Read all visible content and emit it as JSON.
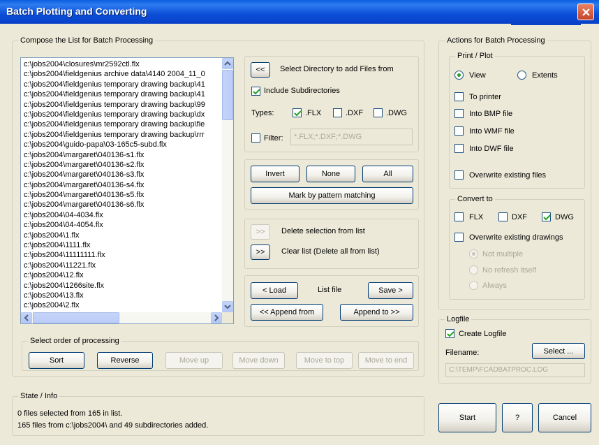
{
  "window": {
    "title": "Batch Plotting and Converting"
  },
  "compose": {
    "legend": "Compose the List for Batch Processing",
    "files": [
      "c:\\jobs2004\\closures\\mr2592ctl.flx",
      "c:\\jobs2004\\fieldgenius archive data\\4140 2004_11_0",
      "c:\\jobs2004\\fieldgenius temporary drawing backup\\41",
      "c:\\jobs2004\\fieldgenius temporary drawing backup\\41",
      "c:\\jobs2004\\fieldgenius temporary drawing backup\\99",
      "c:\\jobs2004\\fieldgenius temporary drawing backup\\dx",
      "c:\\jobs2004\\fieldgenius temporary drawing backup\\fie",
      "c:\\jobs2004\\fieldgenius temporary drawing backup\\rrr",
      "c:\\jobs2004\\guido-papa\\03-165c5-subd.flx",
      "c:\\jobs2004\\margaret\\040136-s1.flx",
      "c:\\jobs2004\\margaret\\040136-s2.flx",
      "c:\\jobs2004\\margaret\\040136-s3.flx",
      "c:\\jobs2004\\margaret\\040136-s4.flx",
      "c:\\jobs2004\\margaret\\040136-s5.flx",
      "c:\\jobs2004\\margaret\\040136-s6.flx",
      "c:\\jobs2004\\04-4034.flx",
      "c:\\jobs2004\\04-4054.flx",
      "c:\\jobs2004\\1.flx",
      "c:\\jobs2004\\1111.flx",
      "c:\\jobs2004\\11111111.flx",
      "c:\\jobs2004\\11221.flx",
      "c:\\jobs2004\\12.flx",
      "c:\\jobs2004\\1266site.flx",
      "c:\\jobs2004\\13.flx",
      "c:\\jobs2004\\2.flx"
    ],
    "select_dir_button": "<<",
    "select_dir_label": "Select Directory to add Files from",
    "include_subdirs": {
      "label": "Include Subdirectories",
      "checked": true
    },
    "types_label": "Types:",
    "types": [
      {
        "label": ".FLX",
        "checked": true
      },
      {
        "label": ".DXF",
        "checked": false
      },
      {
        "label": ".DWG",
        "checked": false
      }
    ],
    "filter": {
      "label": "Filter:",
      "checked": false,
      "value": "*.FLX;*.DXF;*.DWG"
    },
    "invert_button": "Invert",
    "none_button": "None",
    "all_button": "All",
    "mark_pattern_button": "Mark by pattern matching",
    "delete_sel_button": ">>",
    "delete_sel_label": "Delete selection from list",
    "clear_list_button": ">>",
    "clear_list_label": "Clear list (Delete all from list)",
    "load_button": "< Load",
    "list_file_label": "List file",
    "save_button": "Save >",
    "append_from_button": "<< Append from",
    "append_to_button": "Append to >>"
  },
  "order": {
    "legend": "Select order of processing",
    "sort_button": "Sort",
    "reverse_button": "Reverse",
    "move_up_button": "Move up",
    "move_down_button": "Move down",
    "move_top_button": "Move to top",
    "move_end_button": "Move to end"
  },
  "state": {
    "legend": "State / Info",
    "line1": "0 files selected from 165 in list.",
    "line2": "165 files from c:\\jobs2004\\ and 49 subdirectories added."
  },
  "actions": {
    "legend": "Actions for Batch Processing",
    "print_plot": {
      "legend": "Print / Plot",
      "view_label": "View",
      "extents_label": "Extents",
      "selected": "View",
      "to_printer": "To printer",
      "into_bmp": "Into BMP file",
      "into_wmf": "Into WMF file",
      "into_dwf": "Into DWF file",
      "overwrite_files": "Overwrite existing files"
    },
    "convert_to": {
      "legend": "Convert to",
      "flx": {
        "label": "FLX",
        "checked": false
      },
      "dxf": {
        "label": "DXF",
        "checked": false
      },
      "dwg": {
        "label": "DWG",
        "checked": true
      },
      "overwrite_drawings": "Overwrite existing drawings",
      "not_multiple": "Not multiple",
      "no_refresh": "No refresh itself",
      "always": "Always"
    },
    "logfile": {
      "legend": "Logfile",
      "create_label": "Create Logfile",
      "create_checked": true,
      "filename_label": "Filename:",
      "select_button": "Select ...",
      "filename_value": "C:\\TEMP\\FCADBATPROC.LOG"
    }
  },
  "footer": {
    "start_button": "Start",
    "help_button": "?",
    "cancel_button": "Cancel"
  }
}
